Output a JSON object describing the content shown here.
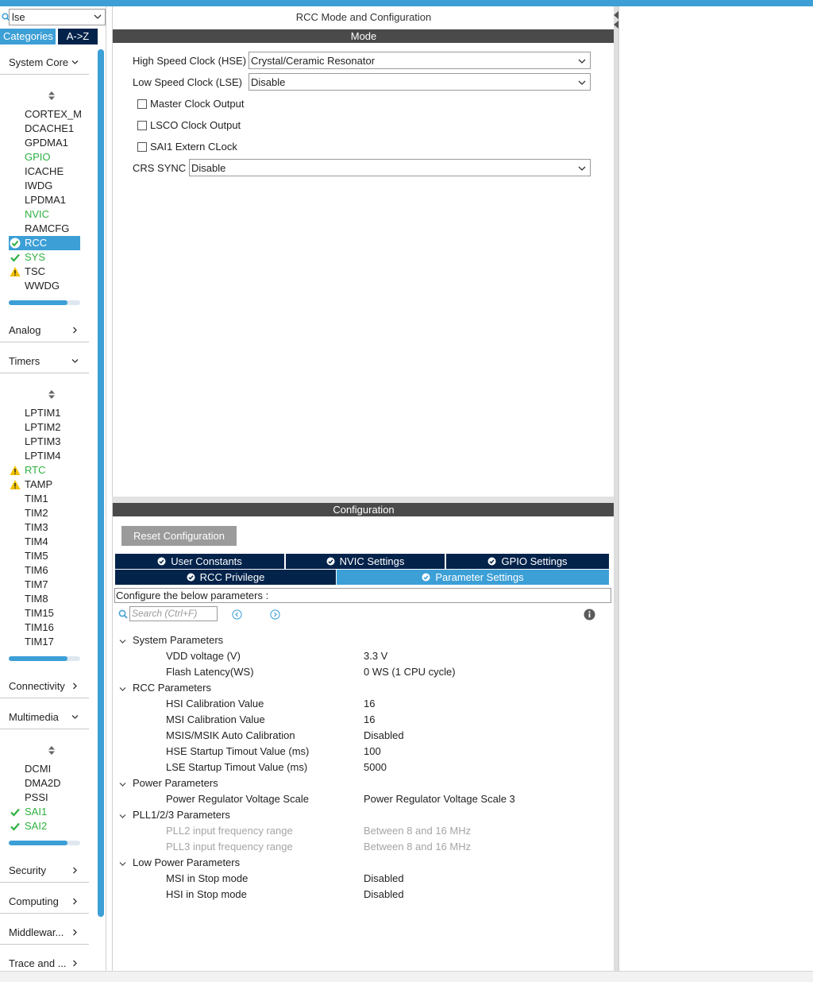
{
  "colors": {
    "accent": "#3c9fd6",
    "navy": "#03234b",
    "ok_green": "#2fb040",
    "warn_yellow": "#f2c200",
    "band_gray": "#4a4a4a"
  },
  "search": {
    "value": "lse"
  },
  "left_tabs": {
    "categories": "Categories",
    "az": "A->Z"
  },
  "categories": [
    {
      "label": "System Core",
      "expanded": true,
      "items": [
        {
          "label": "CORTEX_M",
          "state": "normal"
        },
        {
          "label": "DCACHE1",
          "state": "normal"
        },
        {
          "label": "GPDMA1",
          "state": "normal"
        },
        {
          "label": "GPIO",
          "state": "green"
        },
        {
          "label": "ICACHE",
          "state": "normal"
        },
        {
          "label": "IWDG",
          "state": "normal"
        },
        {
          "label": "LPDMA1",
          "state": "normal"
        },
        {
          "label": "NVIC",
          "state": "green"
        },
        {
          "label": "RAMCFG",
          "state": "normal"
        },
        {
          "label": "RCC",
          "state": "selected-ok"
        },
        {
          "label": "SYS",
          "state": "ok"
        },
        {
          "label": "TSC",
          "state": "warn-plain"
        },
        {
          "label": "WWDG",
          "state": "normal"
        }
      ],
      "scroll_fraction": 0.82
    },
    {
      "label": "Analog",
      "expanded": false
    },
    {
      "label": "Timers",
      "expanded": true,
      "items": [
        {
          "label": "LPTIM1",
          "state": "normal"
        },
        {
          "label": "LPTIM2",
          "state": "normal"
        },
        {
          "label": "LPTIM3",
          "state": "normal"
        },
        {
          "label": "LPTIM4",
          "state": "normal"
        },
        {
          "label": "RTC",
          "state": "warn"
        },
        {
          "label": "TAMP",
          "state": "warn-plain"
        },
        {
          "label": "TIM1",
          "state": "normal"
        },
        {
          "label": "TIM2",
          "state": "normal"
        },
        {
          "label": "TIM3",
          "state": "normal"
        },
        {
          "label": "TIM4",
          "state": "normal"
        },
        {
          "label": "TIM5",
          "state": "normal"
        },
        {
          "label": "TIM6",
          "state": "normal"
        },
        {
          "label": "TIM7",
          "state": "normal"
        },
        {
          "label": "TIM8",
          "state": "normal"
        },
        {
          "label": "TIM15",
          "state": "normal"
        },
        {
          "label": "TIM16",
          "state": "normal"
        },
        {
          "label": "TIM17",
          "state": "normal"
        }
      ],
      "scroll_fraction": 0.82
    },
    {
      "label": "Connectivity",
      "expanded": false
    },
    {
      "label": "Multimedia",
      "expanded": true,
      "items": [
        {
          "label": "DCMI",
          "state": "normal"
        },
        {
          "label": "DMA2D",
          "state": "normal"
        },
        {
          "label": "PSSI",
          "state": "normal"
        },
        {
          "label": "SAI1",
          "state": "ok"
        },
        {
          "label": "SAI2",
          "state": "ok"
        }
      ],
      "scroll_fraction": 0.82
    },
    {
      "label": "Security",
      "expanded": false
    },
    {
      "label": "Computing",
      "expanded": false
    },
    {
      "label": "Middlewar...",
      "expanded": false
    },
    {
      "label": "Trace and ...",
      "expanded": false
    }
  ],
  "mode_panel": {
    "title": "RCC Mode and Configuration",
    "band": "Mode",
    "hse_label": "High Speed Clock (HSE)",
    "hse_value": "Crystal/Ceramic Resonator",
    "lse_label": "Low Speed Clock (LSE)",
    "lse_value": "Disable",
    "checkboxes": [
      "Master Clock Output",
      "LSCO Clock Output",
      "SAI1 Extern CLock"
    ],
    "crs_label": "CRS SYNC",
    "crs_value": "Disable"
  },
  "config_panel": {
    "band": "Configuration",
    "reset_label": "Reset Configuration",
    "tabs": {
      "user_constants": "User Constants",
      "nvic_settings": "NVIC Settings",
      "gpio_settings": "GPIO Settings",
      "rcc_privilege": "RCC Privilege",
      "parameter_settings": "Parameter Settings"
    },
    "description": "Configure the below parameters :",
    "search_placeholder": "Search (Ctrl+F)",
    "groups": [
      {
        "name": "System Parameters",
        "params": [
          {
            "name": "VDD voltage (V)",
            "value": "3.3 V"
          },
          {
            "name": "Flash Latency(WS)",
            "value": "0 WS (1 CPU cycle)"
          }
        ]
      },
      {
        "name": "RCC Parameters",
        "params": [
          {
            "name": "HSI Calibration Value",
            "value": "16"
          },
          {
            "name": "MSI Calibration Value",
            "value": "16"
          },
          {
            "name": "MSIS/MSIK Auto Calibration",
            "value": "Disabled"
          },
          {
            "name": "HSE Startup Timout Value (ms)",
            "value": "100"
          },
          {
            "name": "LSE Startup Timout Value (ms)",
            "value": "5000"
          }
        ]
      },
      {
        "name": "Power Parameters",
        "params": [
          {
            "name": "Power Regulator Voltage Scale",
            "value": "Power Regulator Voltage Scale 3"
          }
        ]
      },
      {
        "name": "PLL1/2/3 Parameters",
        "params": [
          {
            "name": "PLL2 input frequency range",
            "value": "Between 8 and 16 MHz",
            "disabled": true
          },
          {
            "name": "PLL3 input frequency range",
            "value": "Between 8 and 16 MHz",
            "disabled": true
          }
        ]
      },
      {
        "name": "Low Power Parameters",
        "params": [
          {
            "name": "MSI in Stop mode",
            "value": "Disabled"
          },
          {
            "name": "HSI in Stop mode",
            "value": "Disabled"
          }
        ]
      }
    ]
  }
}
